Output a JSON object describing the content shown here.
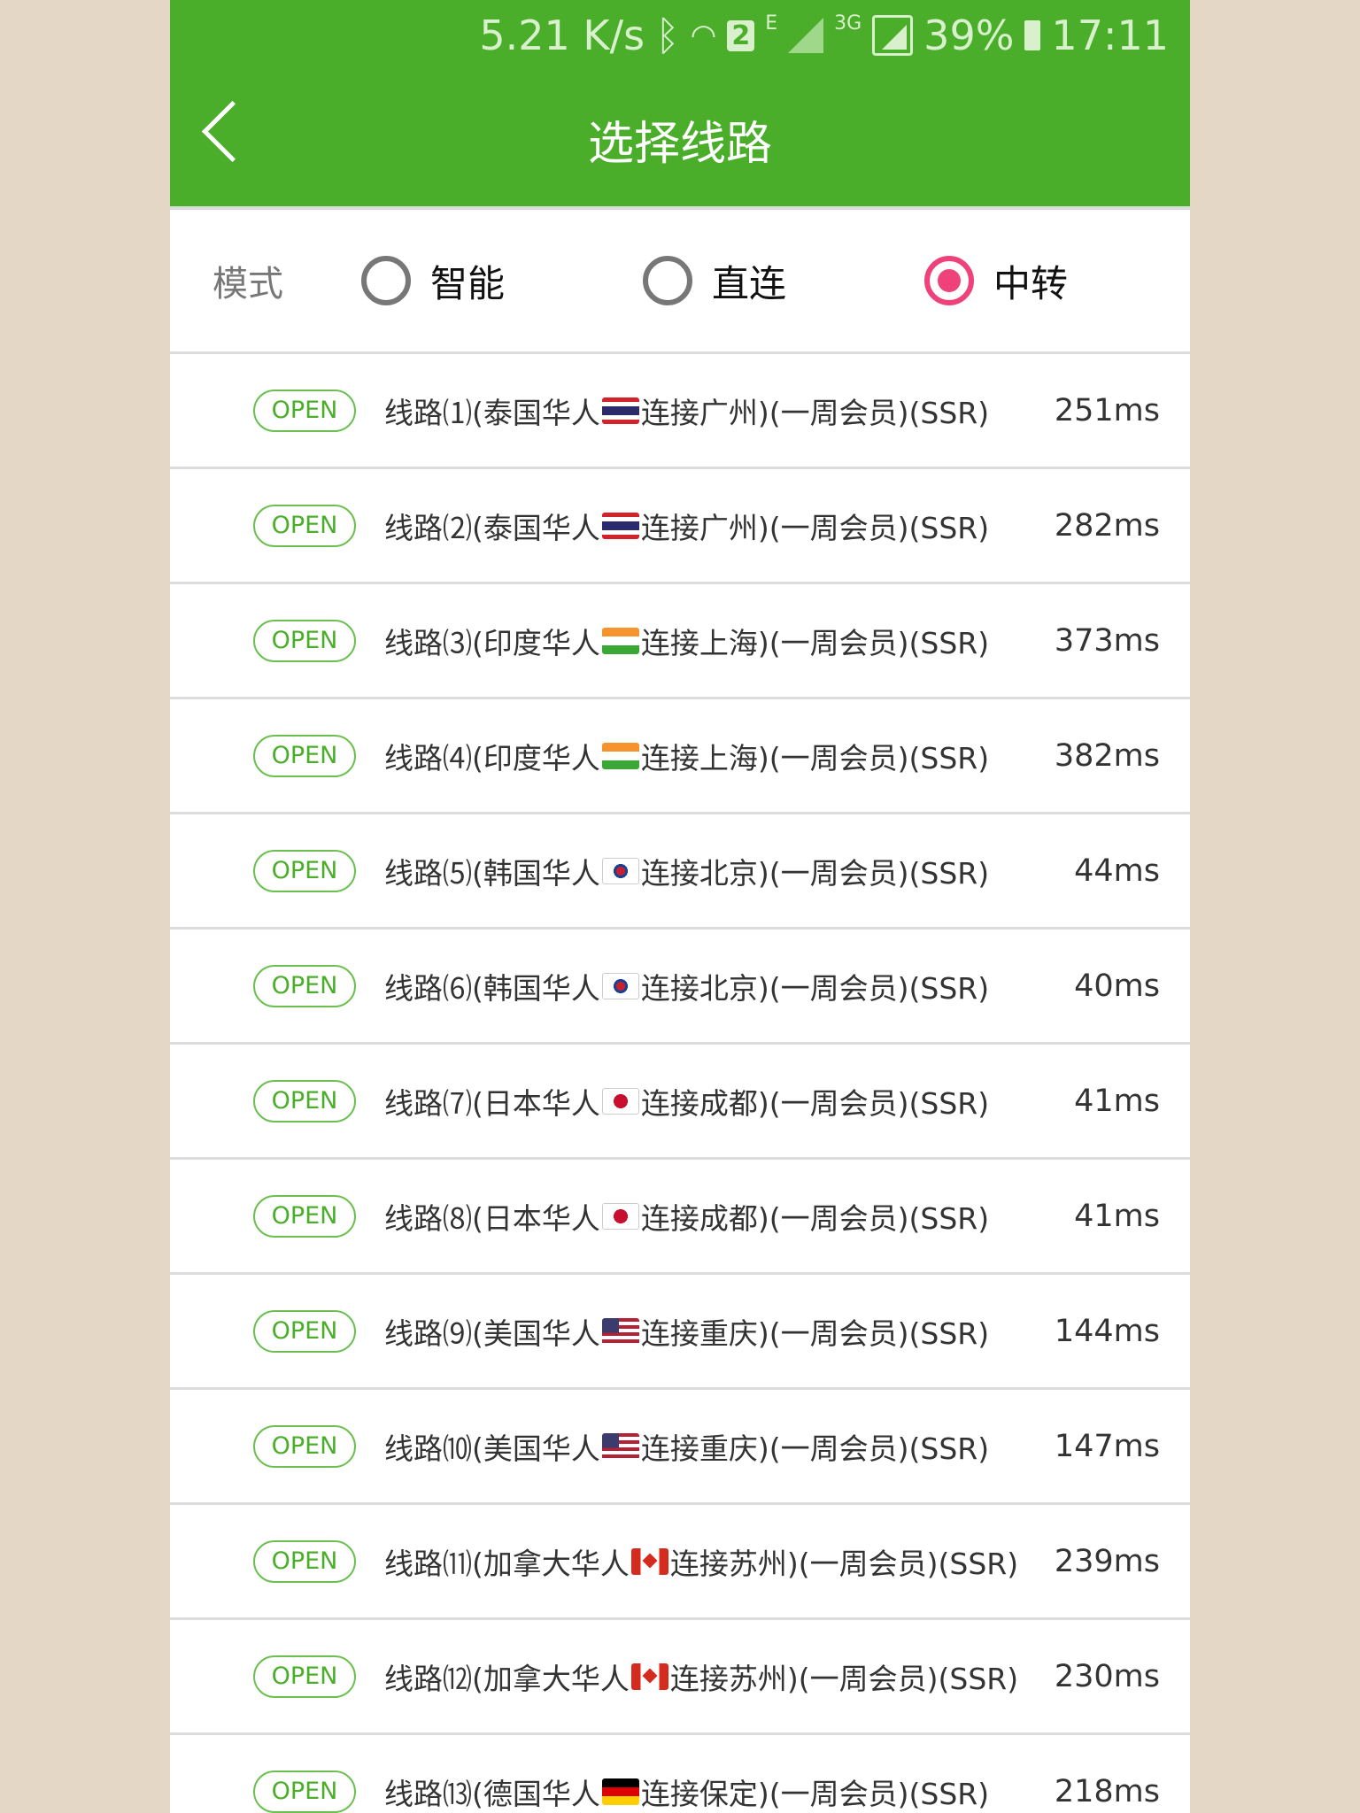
{
  "status_bar": {
    "speed": "5.21 K/s",
    "sim": "2",
    "net1": "E",
    "net2": "3G",
    "battery": "39%",
    "time": "17:11"
  },
  "header": {
    "title": "选择线路",
    "back_icon": "chevron-left-icon"
  },
  "mode": {
    "label": "模式",
    "options": [
      {
        "label": "智能",
        "selected": false
      },
      {
        "label": "直连",
        "selected": false
      },
      {
        "label": "中转",
        "selected": true
      }
    ]
  },
  "colors": {
    "brand": "#4aae2b",
    "radio_selected": "#f0427a",
    "badge": "#4aae2b"
  },
  "routes": [
    {
      "badge": "OPEN",
      "before": "线路⑴(泰国华人",
      "flag": "th",
      "after": "连接广州)(一周会员)(SSR)",
      "ping": "251ms"
    },
    {
      "badge": "OPEN",
      "before": "线路⑵(泰国华人",
      "flag": "th",
      "after": "连接广州)(一周会员)(SSR)",
      "ping": "282ms"
    },
    {
      "badge": "OPEN",
      "before": "线路⑶(印度华人",
      "flag": "in",
      "after": "连接上海)(一周会员)(SSR)",
      "ping": "373ms"
    },
    {
      "badge": "OPEN",
      "before": "线路⑷(印度华人",
      "flag": "in",
      "after": "连接上海)(一周会员)(SSR)",
      "ping": "382ms"
    },
    {
      "badge": "OPEN",
      "before": "线路⑸(韩国华人",
      "flag": "kr",
      "after": "连接北京)(一周会员)(SSR)",
      "ping": "44ms"
    },
    {
      "badge": "OPEN",
      "before": "线路⑹(韩国华人",
      "flag": "kr",
      "after": "连接北京)(一周会员)(SSR)",
      "ping": "40ms"
    },
    {
      "badge": "OPEN",
      "before": "线路⑺(日本华人",
      "flag": "jp",
      "after": "连接成都)(一周会员)(SSR)",
      "ping": "41ms"
    },
    {
      "badge": "OPEN",
      "before": "线路⑻(日本华人",
      "flag": "jp",
      "after": "连接成都)(一周会员)(SSR)",
      "ping": "41ms"
    },
    {
      "badge": "OPEN",
      "before": "线路⑼(美国华人",
      "flag": "us",
      "after": "连接重庆)(一周会员)(SSR)",
      "ping": "144ms"
    },
    {
      "badge": "OPEN",
      "before": "线路⑽(美国华人",
      "flag": "us",
      "after": "连接重庆)(一周会员)(SSR)",
      "ping": "147ms"
    },
    {
      "badge": "OPEN",
      "before": "线路⑾(加拿大华人",
      "flag": "ca",
      "after": "连接苏州)(一周会员)(SSR)",
      "ping": "239ms"
    },
    {
      "badge": "OPEN",
      "before": "线路⑿(加拿大华人",
      "flag": "ca",
      "after": "连接苏州)(一周会员)(SSR)",
      "ping": "230ms"
    },
    {
      "badge": "OPEN",
      "before": "线路⒀(德国华人",
      "flag": "de",
      "after": "连接保定)(一周会员)(SSR)",
      "ping": "218ms"
    }
  ]
}
